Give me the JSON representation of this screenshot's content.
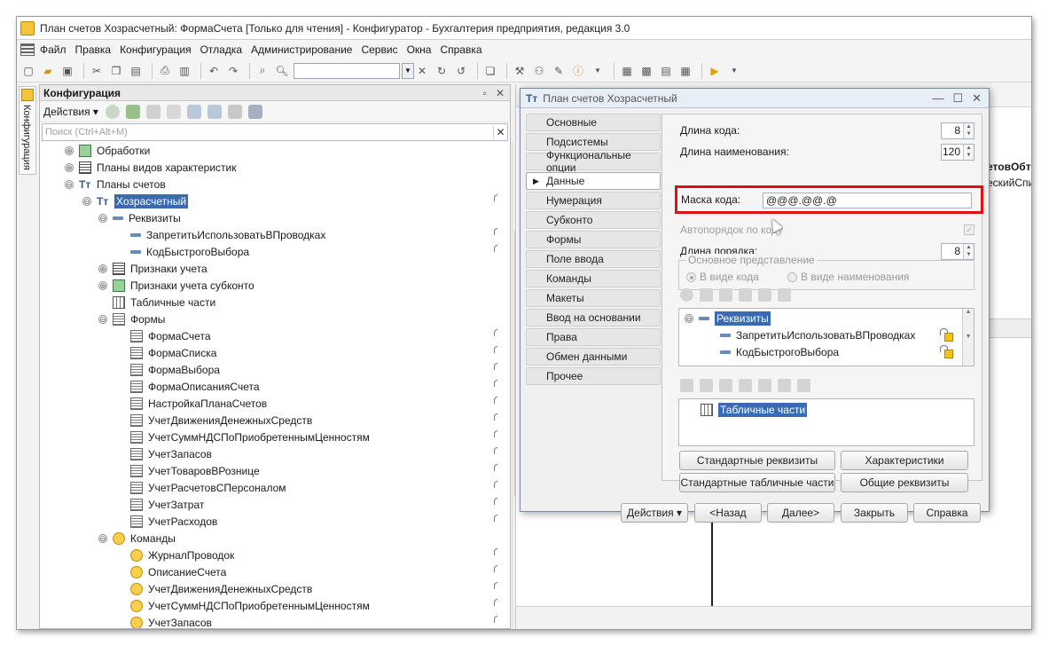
{
  "window": {
    "title": "План счетов Хозрасчетный: ФормаСчета [Только для чтения] - Конфигуратор - Бухгалтерия предприятия, редакция 3.0"
  },
  "menu": [
    "Файл",
    "Правка",
    "Конфигурация",
    "Отладка",
    "Администрирование",
    "Сервис",
    "Окна",
    "Справка"
  ],
  "side_tab": {
    "label": "Конфигурация"
  },
  "config_panel": {
    "title": "Конфигурация",
    "actions_label": "Действия",
    "search_placeholder": "Поиск (Ctrl+Alt+M)",
    "tree": [
      {
        "label": "Обработки",
        "toggle": "⊕",
        "icon": "proc",
        "indent": 0,
        "lock": false
      },
      {
        "label": "Планы видов характеристик",
        "toggle": "⊕",
        "icon": "grid",
        "indent": 0,
        "lock": false
      },
      {
        "label": "Планы счетов",
        "toggle": "⊖",
        "icon": "plan",
        "indent": 0,
        "lock": false
      },
      {
        "label": "Хозрасчетный",
        "toggle": "⊖",
        "icon": "plan",
        "indent": 1,
        "lock": true,
        "selected": true
      },
      {
        "label": "Реквизиты",
        "toggle": "⊖",
        "icon": "attr",
        "indent": 2,
        "lock": false
      },
      {
        "label": "ЗапретитьИспользоватьВПроводках",
        "toggle": "",
        "icon": "attr",
        "indent": 3,
        "lock": true
      },
      {
        "label": "КодБыстрогоВыбора",
        "toggle": "",
        "icon": "attr",
        "indent": 3,
        "lock": true
      },
      {
        "label": "Признаки учета",
        "toggle": "⊕",
        "icon": "grid",
        "indent": 2,
        "lock": false
      },
      {
        "label": "Признаки учета субконто",
        "toggle": "⊕",
        "icon": "proc",
        "indent": 2,
        "lock": false
      },
      {
        "label": "Табличные части",
        "toggle": "",
        "icon": "table",
        "indent": 2,
        "lock": false
      },
      {
        "label": "Формы",
        "toggle": "⊖",
        "icon": "form",
        "indent": 2,
        "lock": false
      },
      {
        "label": "ФормаСчета",
        "toggle": "",
        "icon": "form",
        "indent": 3,
        "lock": true
      },
      {
        "label": "ФормаСписка",
        "toggle": "",
        "icon": "form",
        "indent": 3,
        "lock": true
      },
      {
        "label": "ФормаВыбора",
        "toggle": "",
        "icon": "form",
        "indent": 3,
        "lock": true
      },
      {
        "label": "ФормаОписанияСчета",
        "toggle": "",
        "icon": "form",
        "indent": 3,
        "lock": true
      },
      {
        "label": "НастройкаПланаСчетов",
        "toggle": "",
        "icon": "form",
        "indent": 3,
        "lock": true
      },
      {
        "label": "УчетДвиженияДенежныхСредств",
        "toggle": "",
        "icon": "form",
        "indent": 3,
        "lock": true
      },
      {
        "label": "УчетСуммНДСПоПриобретеннымЦенностям",
        "toggle": "",
        "icon": "form",
        "indent": 3,
        "lock": true
      },
      {
        "label": "УчетЗапасов",
        "toggle": "",
        "icon": "form",
        "indent": 3,
        "lock": true
      },
      {
        "label": "УчетТоваровВРознице",
        "toggle": "",
        "icon": "form",
        "indent": 3,
        "lock": true
      },
      {
        "label": "УчетРасчетовСПерсоналом",
        "toggle": "",
        "icon": "form",
        "indent": 3,
        "lock": true
      },
      {
        "label": "УчетЗатрат",
        "toggle": "",
        "icon": "form",
        "indent": 3,
        "lock": true
      },
      {
        "label": "УчетРасходов",
        "toggle": "",
        "icon": "form",
        "indent": 3,
        "lock": true
      },
      {
        "label": "Команды",
        "toggle": "⊖",
        "icon": "cmd",
        "indent": 2,
        "lock": false
      },
      {
        "label": "ЖурналПроводок",
        "toggle": "",
        "icon": "cmd",
        "indent": 3,
        "lock": true
      },
      {
        "label": "ОписаниеСчета",
        "toggle": "",
        "icon": "cmd",
        "indent": 3,
        "lock": true
      },
      {
        "label": "УчетДвиженияДенежныхСредств",
        "toggle": "",
        "icon": "cmd",
        "indent": 3,
        "lock": true
      },
      {
        "label": "УчетСуммНДСПоПриобретеннымЦенностям",
        "toggle": "",
        "icon": "cmd",
        "indent": 3,
        "lock": true
      },
      {
        "label": "УчетЗапасов",
        "toggle": "",
        "icon": "cmd",
        "indent": 3,
        "lock": true
      }
    ]
  },
  "background_window": {
    "text1": "етовОбт",
    "text2": "ескийСпи"
  },
  "dialog": {
    "title": "План счетов Хозрасчетный",
    "nav": [
      "Основные",
      "Подсистемы",
      "Функциональные опции",
      "Данные",
      "Нумерация",
      "Субконто",
      "Формы",
      "Поле ввода",
      "Команды",
      "Макеты",
      "Ввод на основании",
      "Права",
      "Обмен данными",
      "Прочее"
    ],
    "active_nav_index": 3,
    "fields": {
      "code_length_label": "Длина кода:",
      "code_length_value": "8",
      "name_length_label": "Длина наименования:",
      "name_length_value": "120",
      "code_mask_label": "Маска кода:",
      "code_mask_value": "@@@.@@.@",
      "auto_order_label": "Автопорядок по коду",
      "order_length_label": "Длина порядка:",
      "order_length_value": "8"
    },
    "main_representation": {
      "label": "Основное представление",
      "option_code": "В виде кода",
      "option_name": "В виде наименования",
      "selected": "В виде кода"
    },
    "attributes_list": {
      "root": "Реквизиты",
      "items": [
        "ЗапретитьИспользоватьВПроводках",
        "КодБыстрогоВыбора"
      ]
    },
    "tabular_parts": {
      "root": "Табличные части"
    },
    "buttons": {
      "standard_attributes": "Стандартные реквизиты",
      "characteristics": "Характеристики",
      "standard_tabular_parts": "Стандартные табличные части",
      "common_attributes": "Общие реквизиты"
    },
    "footer": {
      "actions": "Действия",
      "back": "<Назад",
      "next": "Далее>",
      "close": "Закрыть",
      "help": "Справка"
    }
  }
}
